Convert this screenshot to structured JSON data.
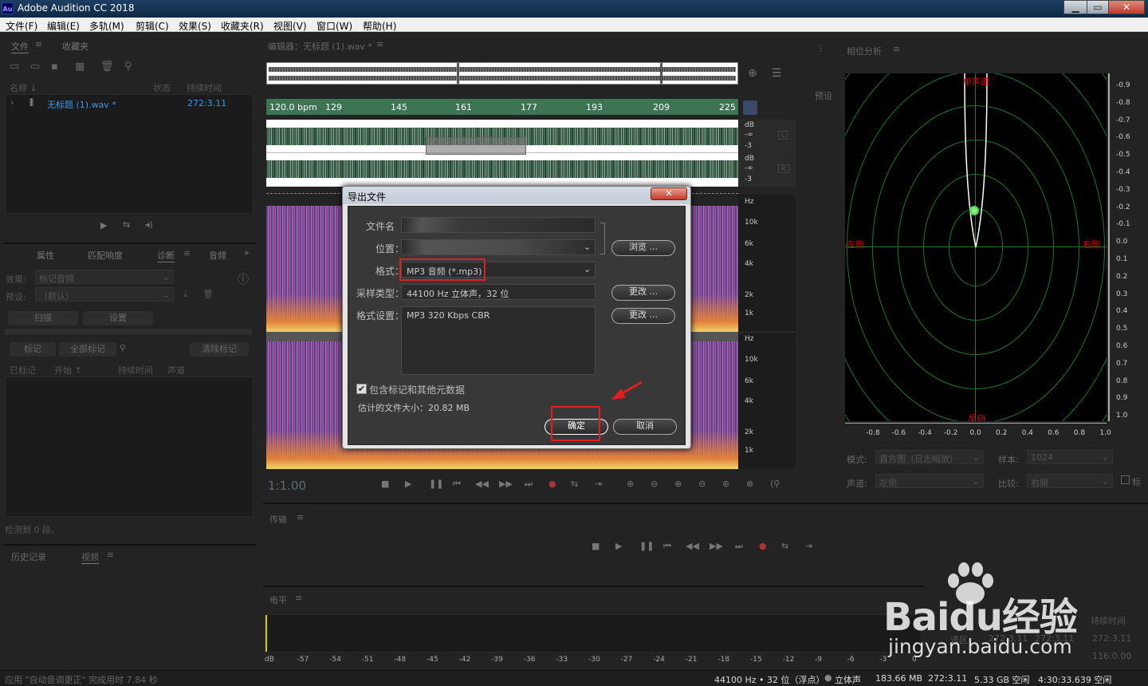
{
  "window": {
    "title": "Adobe Audition CC 2018",
    "icon": "Au",
    "min": "▁",
    "max": "▭",
    "close": "✕"
  },
  "menu": [
    "文件(F)",
    "编辑(E)",
    "多轨(M)",
    "剪辑(C)",
    "效果(S)",
    "收藏夹(R)",
    "视图(V)",
    "窗口(W)",
    "帮助(H)"
  ],
  "files_panel": {
    "tab1": "文件",
    "tab2": "收藏夹",
    "col_name": "名称 ↓",
    "col_status": "状态",
    "col_duration": "持续时间",
    "file_name": "无标题 (1).wav *",
    "file_duration": "272:3.11"
  },
  "props_panel": {
    "tab_props": "属性",
    "tab_match": "匹配响度",
    "tab_diag": "诊断",
    "tab_audio": "音频",
    "effect_label": "效果:",
    "effect_value": "标记音频",
    "preset_label": "预设:",
    "preset_value": "（默认）",
    "scan_btn": "扫描",
    "settings_btn": "设置",
    "mark_btn": "标记",
    "mark_all_btn": "全部标记",
    "clear_btn": "清除标记",
    "col_marked": "已标记",
    "col_start": "开始 ↑",
    "col_duration": "持续时间",
    "col_channel": "声道",
    "detected": "检测到 0 段。"
  },
  "history_panel": {
    "tab_history": "历史记录",
    "tab_video": "视频"
  },
  "editor": {
    "title": "编辑器：无标题 (1).wav *",
    "bpm": "120.0 bpm",
    "ruler": [
      "129",
      "145",
      "161",
      "177",
      "193",
      "209",
      "225"
    ],
    "db_labels": [
      "dB",
      "-∞",
      "-3",
      "dB",
      "-∞",
      "-3"
    ],
    "ch_left": "L",
    "ch_right": "R",
    "hz_labels": [
      "Hz",
      "10k",
      "6k",
      "4k",
      "2k",
      "1k",
      "Hz",
      "10k",
      "6k",
      "4k",
      "2k",
      "1k"
    ],
    "time": "1:1.00"
  },
  "side_tab": "预设",
  "phase_panel": {
    "title": "相位分析",
    "top": "单声道",
    "bottom": "反向",
    "left": "左侧",
    "right": "右侧",
    "x_ticks": [
      "-0.8",
      "-0.6",
      "-0.4",
      "-0.2",
      "0.0",
      "0.2",
      "0.4",
      "0.6",
      "0.8",
      "1.0"
    ],
    "y_ticks": [
      "-0.9",
      "-0.8",
      "-0.7",
      "-0.6",
      "-0.5",
      "-0.4",
      "-0.3",
      "-0.2",
      "-0.1",
      "0.0",
      "0.1",
      "0.2",
      "0.3",
      "0.4",
      "0.5",
      "0.6",
      "0.7",
      "0.8",
      "0.9",
      "1.0"
    ],
    "mode_label": "模式:",
    "mode_value": "直方图（日志缩放）",
    "sample_label": "样本:",
    "sample_value": "1024",
    "channel_label": "声道:",
    "channel_value": "左侧",
    "compare_label": "比较:",
    "compare_value": "右侧",
    "extra": "标"
  },
  "transport_panel": {
    "title": "传输"
  },
  "levels_panel": {
    "title": "电平",
    "scale": [
      "dB",
      "-57",
      "-54",
      "-51",
      "-48",
      "-45",
      "-42",
      "-39",
      "-36",
      "-33",
      "-30",
      "-27",
      "-24",
      "-21",
      "-18",
      "-15",
      "-12",
      "-9",
      "-6",
      "-3",
      "0"
    ]
  },
  "selection_panel": {
    "col_duration": "持续时间",
    "r1": "272:3.11",
    "r2": "116:0.00",
    "r3": "选区",
    "r4": "272:3.11",
    "r5": "272:3.11"
  },
  "watermark": {
    "brand": "Baidu经验",
    "url": "jingyan.baidu.com"
  },
  "status": {
    "left": "应用 \"自动音调更正\" 完成用时 7.84 秒",
    "rate": "44100 Hz • 32 位（浮点）",
    "stereo": "立体声",
    "mem": "183.66 MB",
    "dur": "272:3.11",
    "disk": "5.33 GB 空闲",
    "free": "4:30:33.639 空闲"
  },
  "dialog": {
    "title": "导出文件",
    "close": "✕",
    "filename_label": "文件名",
    "location_label": "位置：",
    "format_label": "格式：",
    "format_value": "MP3 音频 (*.mp3)",
    "sample_label": "采样类型：",
    "sample_value": "44100 Hz 立体声，32 位",
    "settings_label": "格式设置：",
    "settings_value": "MP3 320 Kbps CBR",
    "browse": "浏览 ...",
    "change1": "更改 ...",
    "change2": "更改 ...",
    "include_meta": "包含标记和其他元数据",
    "est_size": "估计的文件大小：20.82 MB",
    "ok": "确定",
    "cancel": "取消"
  }
}
